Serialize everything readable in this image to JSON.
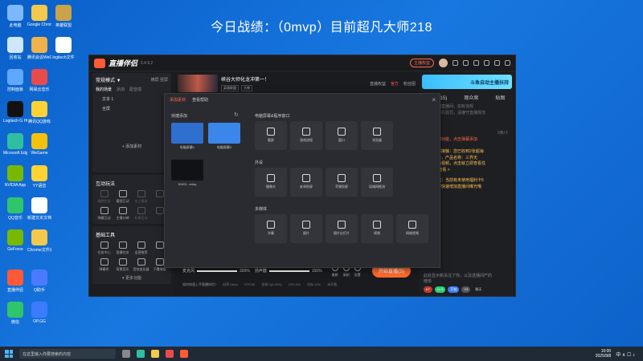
{
  "headline": "今日战绩：（0mvp）目前超凡大师218",
  "desktop_icons": [
    {
      "label": "此电脑",
      "color": "#7bb8ff"
    },
    {
      "label": "Google Chrome",
      "color": "#f2c94c"
    },
    {
      "label": "英雄联盟",
      "color": "#c9a24a"
    },
    {
      "label": "回收站",
      "color": "#cfe6ff"
    },
    {
      "label": "腾讯会议WeGame",
      "color": "#f0b24a"
    },
    {
      "label": "logitech文件",
      "color": "#ffffff"
    },
    {
      "label": "控制面板",
      "color": "#5ea8ff"
    },
    {
      "label": "网易云音乐",
      "color": "#e94b4b"
    },
    {
      "label": "Logitech G HUB",
      "color": "#111111"
    },
    {
      "label": "腾讯QQ游戏",
      "color": "#ffd233"
    },
    {
      "label": "Microsoft Edge",
      "color": "#2fbfa0"
    },
    {
      "label": "WeGame",
      "color": "#f4c20d"
    },
    {
      "label": "NVIDIA App",
      "color": "#76b900"
    },
    {
      "label": "YY语音",
      "color": "#ffd233"
    },
    {
      "label": "QQ音乐",
      "color": "#2fc56a"
    },
    {
      "label": "新建文本文档",
      "color": "#ffffff"
    },
    {
      "label": "GeForce",
      "color": "#76b900"
    },
    {
      "label": "Chrome文件夹",
      "color": "#f2c94c"
    },
    {
      "label": "直播伴侣",
      "color": "#ff5a37"
    },
    {
      "label": "Q助手",
      "color": "#4a7bff"
    },
    {
      "label": "微信",
      "color": "#2fc56a"
    },
    {
      "label": "OP.GG",
      "color": "#3b7bff"
    }
  ],
  "app": {
    "name": "直播伴侣",
    "version": "6.4.9.2",
    "pill": "主播权益",
    "top_actions": [
      "开播提醒",
      "分享"
    ]
  },
  "left": {
    "mode": "常规模式 ▼",
    "mode_actions": "横屏  竖屏",
    "tabs": [
      "我的场景",
      "添加",
      "配音插"
    ],
    "scenes": [
      "文本 1",
      "全屏"
    ],
    "add_source": "+ 添加素材",
    "interactive_title": "互动玩法",
    "interactive_tools": [
      {
        "label": "福袋礼包",
        "dim": true
      },
      {
        "label": "看图互动",
        "dim": false
      },
      {
        "label": "水上狙击",
        "dim": true
      },
      {
        "label": "",
        "dim": true
      },
      {
        "label": "弹幕互动",
        "dim": false
      },
      {
        "label": "主播口碑",
        "dim": false
      },
      {
        "label": "礼物互动",
        "dim": true
      },
      {
        "label": "",
        "dim": true
      }
    ],
    "basic_title": "基础工具",
    "basic_tools": [
      "任务中心",
      "直播任务",
      "运营推荐",
      "",
      "弹幕秀",
      "背景音乐",
      "音效变化器",
      "下播海报"
    ],
    "more": "▾ 更多功能"
  },
  "center": {
    "live_title": "峡谷大师化龙冲第一！",
    "live_tags": [
      "英雄联盟",
      "大神"
    ],
    "live_right": [
      "直播权益",
      "官方",
      "粉丝团"
    ],
    "volume_mic_label": "麦克风",
    "volume_mic_value": "300%",
    "volume_spk_label": "扬声器",
    "volume_spk_value": "150%",
    "actions": [
      "美颜",
      "录制",
      "设置"
    ],
    "start_button": "开始直播(S)",
    "status": [
      "如何快速上手直播伴侣?",
      "码率:0kb/s",
      "FPS:60",
      "丢帧:0(0.00%)",
      "CPU:5%",
      "内存:13%",
      "未开播"
    ]
  },
  "right": {
    "banner": "斗鱼自动主播扶持",
    "tabs": [
      "对手(15)",
      "观众席",
      "贴图"
    ],
    "lines": [
      "欢迎来到直播间，如有违规",
      "平台将进行处罚，请遵守直播规范",
      "0条/人",
      "弹幕查询功能，点击弹幕添加",
      "主播身体接触：您已收到2张超海",
      "报的任务，产品名称：三界无",
      "忧之彩的视频，点击就立即查看任",
      "务。 去查看 >",
      "风控提醒：当前有未使用福利卡5",
      "张，即可快速增加直播间曝光哦",
      "此处显示新关注了你，以及送播间产的",
      "榜单"
    ],
    "badge_a": "K7",
    "badge_b": "Lv 5",
    "badge_c": "开始",
    "badge_d": "V3",
    "badge_e": "聊天"
  },
  "modal": {
    "tabs": [
      "添加素材",
      "查看帮助"
    ],
    "close": "×",
    "quick_add": "快捷添加",
    "quick_cards": [
      {
        "label": "电脑屏幕1",
        "bg": "#2f6fd0"
      },
      {
        "label": "电脑屏幕2",
        "bg": "#3b86ea"
      },
      {
        "label": "NVIDI...erlay",
        "bg": "#111216"
      }
    ],
    "cat_screen": "电脑屏幕&程序窗口",
    "screen_sources": [
      "截屏",
      "游戏进程",
      "窗口",
      "浏览器"
    ],
    "cat_device": "外设",
    "device_sources": [
      "摄像头",
      "安卓投屏",
      "苹果投屏",
      "局域网推流"
    ],
    "cat_media": "多媒体",
    "media_sources": [
      "字幕",
      "图片",
      "图片幻灯片",
      "视频",
      "网络视频"
    ]
  },
  "taskbar": {
    "search": "在这里输入你要搜索的内容",
    "time": "10:00",
    "date": "2025/9/8",
    "tray": "中  ∧  ☐  ♪"
  }
}
